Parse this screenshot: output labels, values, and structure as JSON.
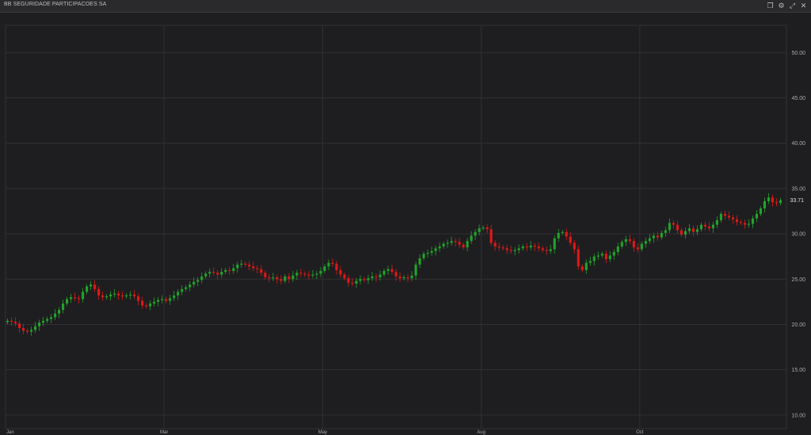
{
  "window": {
    "title": "BB SEGURIDADE PARTICIPACOES SA",
    "buttons": [
      {
        "name": "window-restore-icon",
        "glyph": "❐"
      },
      {
        "name": "settings-sliders-icon",
        "glyph": "⚙"
      },
      {
        "name": "expand-icon",
        "glyph": "⤢"
      },
      {
        "name": "close-icon",
        "glyph": "✕"
      }
    ],
    "collapse_glyph": "⌄"
  },
  "chart_data": {
    "type": "candlestick",
    "title": "BB SEGURIDADE PARTICIPACOES SA",
    "xlabel": "",
    "ylabel": "",
    "ylim": [
      8.5,
      53.0
    ],
    "yticks": [
      "10.00",
      "15.00",
      "20.00",
      "25.00",
      "30.00",
      "35.00",
      "40.00",
      "45.00",
      "50.00"
    ],
    "xticks": [
      {
        "label": "Jan",
        "t": 0
      },
      {
        "label": "Mar",
        "t": 40
      },
      {
        "label": "May",
        "t": 80
      },
      {
        "label": "Aug",
        "t": 120
      },
      {
        "label": "Oct",
        "t": 160
      }
    ],
    "t_range": [
      0,
      197
    ],
    "grid": true,
    "up_color": "#22a32b",
    "down_color": "#e01818",
    "last_price": "33.71",
    "closes": [
      20.4,
      20.3,
      20.1,
      19.6,
      19.3,
      19.2,
      19.4,
      19.8,
      20.2,
      20.4,
      20.6,
      20.8,
      21.2,
      21.6,
      22.3,
      22.8,
      23.0,
      22.9,
      22.8,
      23.6,
      24.2,
      24.4,
      23.9,
      23.2,
      23.0,
      23.1,
      23.3,
      23.4,
      23.2,
      23.1,
      23.2,
      23.3,
      23.1,
      22.6,
      22.1,
      22.0,
      22.3,
      22.5,
      22.7,
      22.8,
      22.6,
      22.9,
      23.2,
      23.6,
      23.9,
      24.1,
      24.4,
      24.7,
      24.9,
      25.3,
      25.6,
      25.8,
      25.7,
      25.5,
      25.8,
      26.0,
      25.9,
      26.2,
      26.6,
      26.7,
      26.6,
      26.4,
      26.2,
      26.1,
      25.7,
      25.2,
      25.1,
      25.2,
      25.0,
      24.8,
      25.3,
      25.0,
      25.4,
      25.7,
      25.6,
      25.5,
      25.4,
      25.5,
      25.6,
      25.9,
      26.4,
      26.8,
      26.7,
      26.0,
      25.5,
      25.1,
      24.6,
      24.5,
      24.8,
      25.0,
      24.9,
      25.1,
      25.3,
      25.2,
      25.5,
      25.9,
      26.1,
      25.8,
      25.3,
      25.1,
      25.2,
      25.1,
      25.4,
      26.6,
      27.3,
      27.8,
      27.9,
      28.1,
      28.4,
      28.6,
      28.9,
      29.0,
      29.2,
      29.1,
      28.8,
      28.5,
      29.2,
      29.8,
      30.2,
      30.6,
      30.7,
      30.5,
      29.0,
      28.6,
      28.5,
      28.4,
      28.2,
      28.1,
      28.2,
      28.4,
      28.6,
      28.5,
      28.7,
      28.6,
      28.4,
      28.2,
      28.1,
      28.3,
      29.5,
      30.1,
      30.2,
      29.7,
      29.0,
      28.3,
      26.4,
      26.0,
      26.8,
      27.0,
      27.5,
      27.6,
      27.8,
      27.2,
      27.6,
      28.0,
      28.6,
      29.1,
      29.4,
      29.2,
      28.5,
      28.3,
      28.9,
      29.2,
      29.5,
      29.8,
      29.6,
      30.1,
      30.4,
      31.2,
      31.0,
      30.4,
      29.9,
      30.3,
      30.6,
      30.2,
      30.5,
      31.0,
      30.8,
      30.6,
      31.0,
      31.5,
      32.2,
      32.0,
      31.8,
      31.6,
      31.3,
      31.2,
      31.0,
      31.1,
      31.7,
      32.2,
      32.8,
      33.6,
      34.0,
      33.5,
      33.4,
      33.71
    ]
  }
}
